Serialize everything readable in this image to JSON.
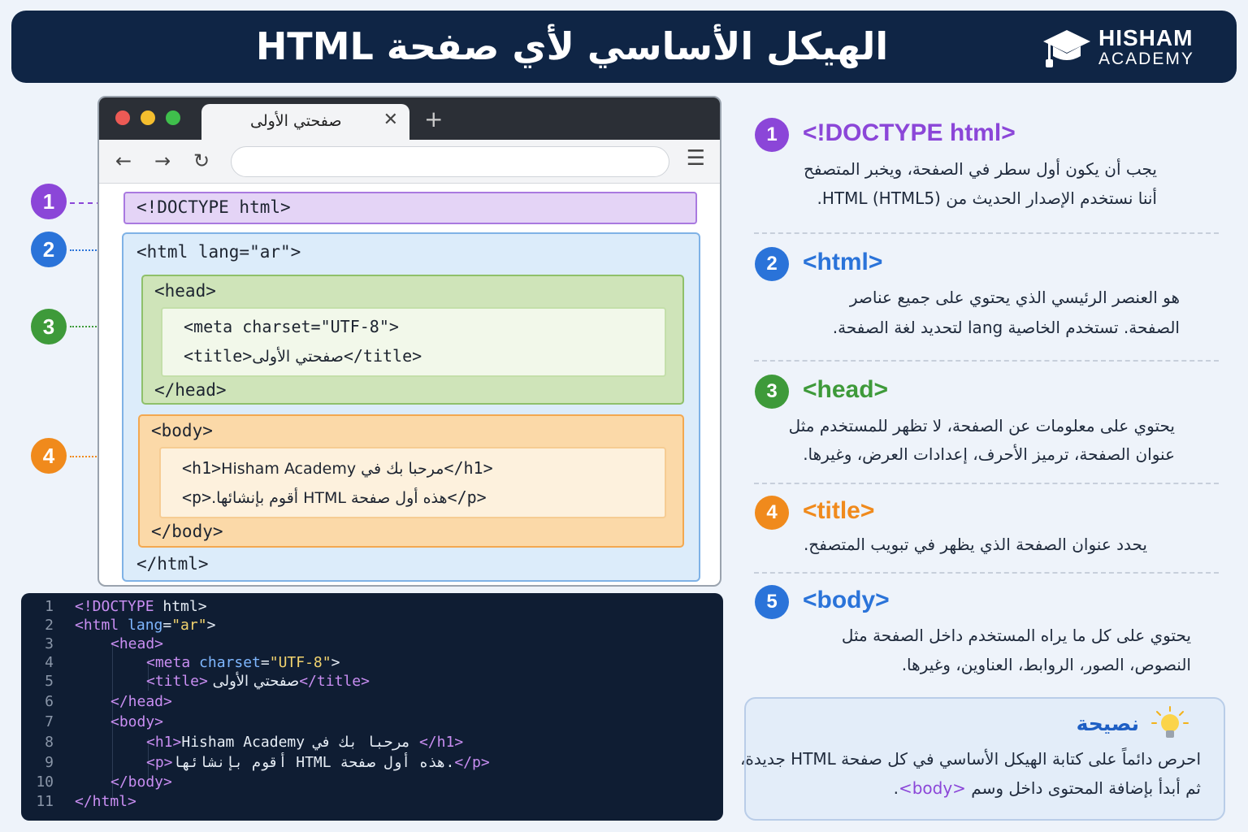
{
  "header": {
    "title": "الهيكل الأساسي لأي صفحة HTML",
    "logo_name": "HISHAM",
    "logo_sub": "ACADEMY"
  },
  "browser": {
    "tab_title": "صفحتي الأولى",
    "tab_close": "✕",
    "new_tab": "+",
    "back": "←",
    "forward": "→",
    "reload": "↻",
    "menu": "☰",
    "code": {
      "doctype": "<!DOCTYPE html>",
      "html_open": "<html lang=\"ar\">",
      "head_open": "<head>",
      "meta": "<meta charset=\"UTF-8\">",
      "title_open": "<title>",
      "title_text": "صفحتي الأولى",
      "title_close": "</title>",
      "head_close": "</head>",
      "body_open": "<body>",
      "h1_open": "<h1>",
      "h1_text": "مرحبا بك في Hisham Academy",
      "h1_close": "</h1>",
      "p_open": "<p>",
      "p_text": "هذه أول صفحة HTML أقوم بإنشائها.",
      "p_close": "</p>",
      "body_close": "</body>",
      "html_close": "</html>"
    }
  },
  "left_badges": [
    "1",
    "2",
    "3",
    "4"
  ],
  "editor": {
    "line_numbers": [
      "1",
      "2",
      "3",
      "4",
      "5",
      "6",
      "7",
      "8",
      "9",
      "10",
      "11"
    ],
    "l1_kw": "<!DOCTYPE",
    "l1_rest": " html>",
    "l2_a": "<html",
    "l2_b": " lang",
    "l2_c": "=",
    "l2_d": "\"ar\"",
    "l2_e": ">",
    "l3": "<head>",
    "l4_a": "<meta",
    "l4_b": " charset",
    "l4_c": "=",
    "l4_d": "\"UTF-8\"",
    "l4_e": ">",
    "l5_a": "<title>",
    "l5_b": " صفحتي الأولى",
    "l5_c": "</title>",
    "l6": "</head>",
    "l7": "<body>",
    "l8_a": "<h1>",
    "l8_b": " مرحبا بك في Hisham Academy",
    "l8_c": "</h1>",
    "l9_a": "<p>",
    "l9_b": ".هذه أول صفحة HTML أقوم بإنشائها",
    "l9_c": "</p>",
    "l10": "</body>",
    "l11": "</html>"
  },
  "items": [
    {
      "num": "1",
      "title": "<!DOCTYPE html>",
      "color": "#8b46d8",
      "lines": [
        "يجب أن يكون أول سطر في الصفحة، ويخبر المتصفح",
        "أننا نستخدم الإصدار الحديث من HTML (HTML5)."
      ]
    },
    {
      "num": "2",
      "title": "<html>",
      "color": "#2a73d9",
      "lines": [
        "هو العنصر الرئيسي الذي يحتوي على جميع عناصر",
        "الصفحة. تستخدم الخاصية lang لتحديد لغة الصفحة."
      ]
    },
    {
      "num": "3",
      "title": "<head>",
      "color": "#3e9a3a",
      "lines": [
        "يحتوي على معلومات عن الصفحة، لا تظهر للمستخدم مثل",
        "عنوان الصفحة، ترميز الأحرف، إعدادات العرض، وغيرها."
      ]
    },
    {
      "num": "4",
      "title": "<title>",
      "color": "#f08a1c",
      "lines": [
        "يحدد عنوان الصفحة الذي يظهر في تبويب المتصفح."
      ]
    },
    {
      "num": "5",
      "title": "<body>",
      "color": "#2a73d9",
      "lines": [
        "يحتوي على كل ما يراه المستخدم داخل الصفحة مثل",
        "النصوص، الصور، الروابط، العناوين، وغيرها."
      ]
    }
  ],
  "tip": {
    "title": "نصيحة",
    "line1": "احرص دائماً على كتابة الهيكل الأساسي في كل صفحة HTML جديدة،",
    "line2_a": "ثم أبدأ بإضافة المحتوى داخل وسم ",
    "line2_b": "<body>",
    "line2_c": "."
  },
  "colors": {
    "purple": "#8b46d8",
    "blue": "#2a73d9",
    "green": "#3e9a3a",
    "orange": "#f08a1c",
    "navy": "#0f2545"
  }
}
